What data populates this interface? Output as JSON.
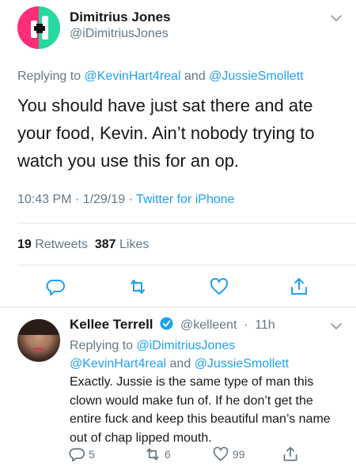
{
  "main_tweet": {
    "name": "Dimitrius Jones",
    "handle": "@iDimitriusJones",
    "replying_prefix": "Replying to",
    "replying_to_1": "@KevinHart4real",
    "replying_and": "and",
    "replying_to_2": "@JussieSmollett",
    "body": "You should have just sat there and ate your food, Kevin. Ain’t nobody trying to watch you use this for an op.",
    "time": "10:43 PM",
    "date": "1/29/19",
    "separator": "·",
    "source": "Twitter for iPhone",
    "retweet_count": "19",
    "retweet_label": "Retweets",
    "like_count": "387",
    "like_label": "Likes"
  },
  "reply_tweet": {
    "name": "Kellee Terrell",
    "handle": "@kelleent",
    "separator": "·",
    "time_ago": "11h",
    "replying_prefix": "Replying to",
    "replying_to_1": "@iDimitriusJones",
    "replying_to_2": "@KevinHart4real",
    "replying_and": "and",
    "replying_to_3": "@JussieSmollett",
    "body": "Exactly. Jussie is the same type of man this clown would make fun of. If he don’t get the entire fuck and keep this beautiful man’s name out of chap lipped mouth.",
    "reply_count": "5",
    "retweet_count": "6",
    "like_count": "99"
  },
  "colors": {
    "accent": "#1da1f2",
    "secondary_text": "#657786",
    "primary_text": "#14171a",
    "divider": "#e1e8ed",
    "logo_pink": "#ff2d7a",
    "logo_green": "#27d9a0"
  },
  "icons": [
    "chevron-down-icon",
    "reply-icon",
    "retweet-icon",
    "like-icon",
    "share-icon",
    "verified-badge-icon"
  ]
}
